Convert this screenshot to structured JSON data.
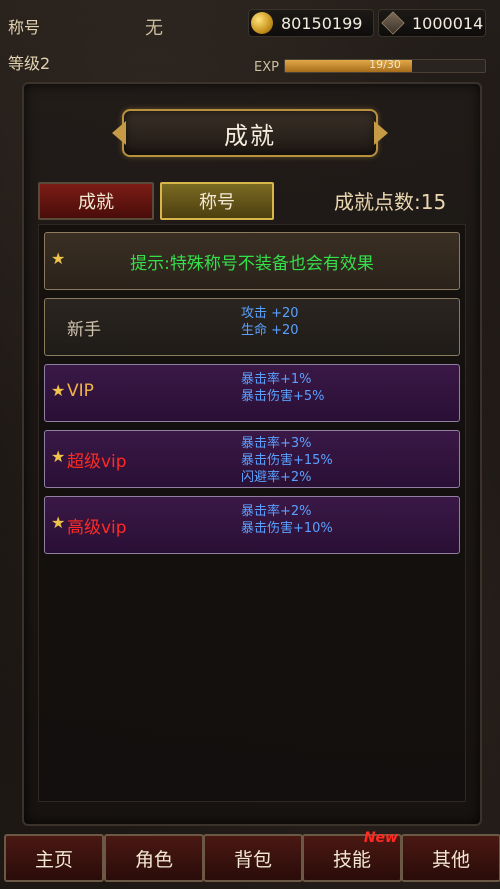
{
  "header": {
    "title_label": "称号",
    "title_value": "无",
    "level_label": "等级2",
    "gold": "80150199",
    "gems": "1000014",
    "exp_label": "EXP",
    "exp_text": "19/30",
    "exp_progress": 0.633
  },
  "banner": {
    "title": "成就"
  },
  "tabs": {
    "achievements": "成就",
    "titles": "称号"
  },
  "points": "成就点数:15",
  "hint": "提示:特殊称号不装备也会有效果",
  "rows": [
    {
      "name": "新手",
      "stats": [
        "攻击 +20",
        "生命 +20"
      ]
    },
    {
      "name": "VIP",
      "stats": [
        "暴击率+1%",
        "暴击伤害+5%"
      ]
    },
    {
      "name": "超级vip",
      "stats": [
        "暴击率+3%",
        "暴击伤害+15%",
        "闪避率+2%"
      ]
    },
    {
      "name": "高级vip",
      "stats": [
        "暴击率+2%",
        "暴击伤害+10%"
      ]
    }
  ],
  "icons": {
    "star": "star-icon",
    "gold": "gold-coin-icon",
    "gem": "gem-icon"
  },
  "nav": {
    "home": "主页",
    "character": "角色",
    "bag": "背包",
    "skills": "技能",
    "skills_badge": "New",
    "other": "其他"
  }
}
